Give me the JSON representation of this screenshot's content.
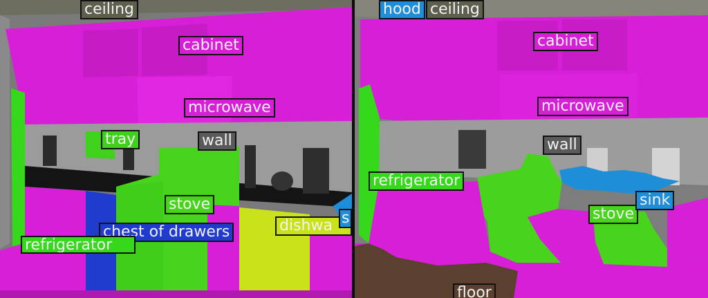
{
  "colors": {
    "cabinet": "#d81fd8",
    "refrigerator": "#35d81a",
    "stove": "#48d41c",
    "microwave": "#d81fd8",
    "chest_of_drawers": "#1f3ccf",
    "dishwasher": "#c9e21a",
    "sink": "#1f8ed8",
    "hood": "#1f8ed8",
    "tray": "#3fd11c",
    "wall": "#5a5a5a",
    "ceiling": "#5f5f4e",
    "floor": "#5b4030",
    "counter": "#141414"
  },
  "left_panel": {
    "labels": {
      "ceiling": "ceiling",
      "cabinet": "cabinet",
      "microwave": "microwave",
      "tray": "tray",
      "wall": "wall",
      "stove": "stove",
      "chest_of_drawers": "chest of drawers",
      "dishwasher": "dishwa",
      "sink": "si",
      "refrigerator": "refrigerator"
    }
  },
  "right_panel": {
    "labels": {
      "hood": "hood",
      "ceiling": "ceiling",
      "cabinet": "cabinet",
      "microwave": "microwave",
      "wall": "wall",
      "refrigerator": "refrigerator",
      "stove": "stove",
      "sink": "sink",
      "floor": "floor"
    }
  }
}
